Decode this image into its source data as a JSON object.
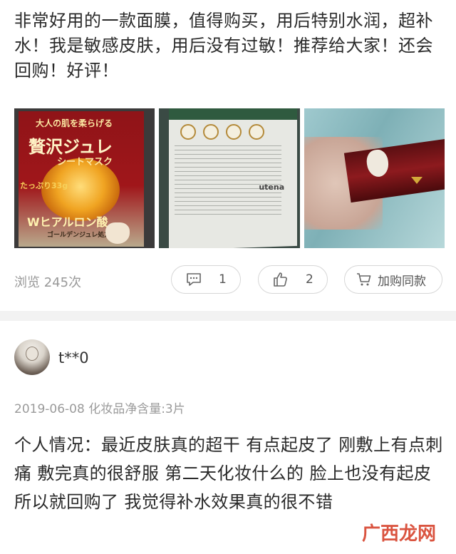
{
  "review": {
    "text": "非常好用的一款面膜，值得购买，用后特别水润，超补水！我是敏感皮肤，用后没有过敏！推荐给大家！还会回购！好评！"
  },
  "photos": [
    {
      "label_1": "大人の肌を柔らげる",
      "label_2": "贅沢ジュレ",
      "label_3": "シートマスク",
      "label_4": "たっぷり33g",
      "label_5": "Wヒアルロン酸",
      "label_6": "ゴールデンジュレ処方"
    },
    {
      "brand": "utena"
    },
    {}
  ],
  "stats": {
    "views_label": "浏览 245次",
    "comment_count": "1",
    "like_count": "2",
    "cart_label": "加购同款"
  },
  "comment": {
    "username": "t**0",
    "meta": "2019-06-08 化妆品净含量:3片",
    "text": "个人情况：最近皮肤真的超干 有点起皮了 刚敷上有点刺痛 敷完真的很舒服 第二天化妆什么的 脸上也没有起皮 所以就回购了 我觉得补水效果真的很不错"
  },
  "watermark": {
    "text": "广西龙网"
  }
}
